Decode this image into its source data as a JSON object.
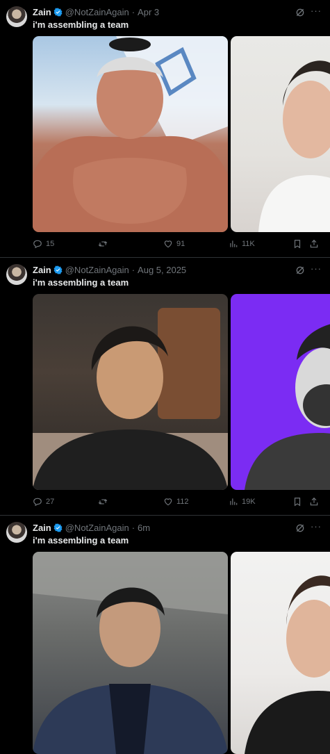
{
  "tweets": [
    {
      "author": {
        "name": "Zain",
        "handle": "@NotZainAgain",
        "time": "Apr 3"
      },
      "text": "i'm assembling a team",
      "stats": {
        "replies": "15",
        "likes": "91",
        "views": "11K"
      }
    },
    {
      "author": {
        "name": "Zain",
        "handle": "@NotZainAgain",
        "time": "Aug 5, 2025"
      },
      "text": "i'm assembling a team",
      "stats": {
        "replies": "27",
        "likes": "112",
        "views": "19K"
      }
    },
    {
      "author": {
        "name": "Zain",
        "handle": "@NotZainAgain",
        "time": "6m"
      },
      "text": "i'm assembling a team",
      "stats": {
        "replies": "",
        "likes": "",
        "views": ""
      }
    }
  ],
  "icons": {
    "verified": "verified-badge-icon",
    "grok": "grok-icon",
    "more": "more-icon",
    "reply": "reply-icon",
    "retweet": "retweet-icon",
    "like": "heart-icon",
    "views": "views-icon",
    "bookmark": "bookmark-icon",
    "share": "share-icon"
  },
  "colors": {
    "background": "#000000",
    "text": "#e7e9ea",
    "muted": "#71767b",
    "verified": "#1d9bf0",
    "divider": "#2f3336"
  }
}
